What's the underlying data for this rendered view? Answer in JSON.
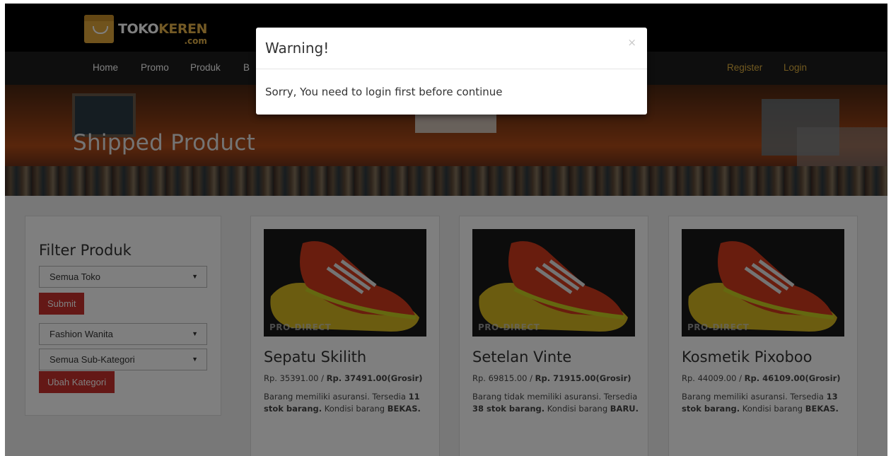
{
  "brand": {
    "name_part1": "TOKO",
    "name_part2": "KEREN",
    "suffix": ".com"
  },
  "nav": {
    "left": [
      "Home",
      "Promo",
      "Produk",
      "B"
    ],
    "right": [
      "Register",
      "Login"
    ]
  },
  "hero": {
    "title": "Shipped Product"
  },
  "filter": {
    "title": "Filter Produk",
    "toko_select": "Semua Toko",
    "submit_label": "Submit",
    "kategori_select": "Fashion Wanita",
    "subkategori_select": "Semua Sub-Kategori",
    "ubah_label": "Ubah Kategori"
  },
  "products": [
    {
      "name": "Sepatu Skilith",
      "price": "Rp. 35391.00 / ",
      "price_grosir": "Rp. 37491.00(Grosir)",
      "desc_pre": "Barang memiliki asuransi. Tersedia ",
      "stock": "11 stok barang.",
      "desc_mid": " Kondisi barang ",
      "condition": "BEKAS.",
      "image_brand": "PRO-DIRECT"
    },
    {
      "name": "Setelan Vinte",
      "price": "Rp. 69815.00 / ",
      "price_grosir": "Rp. 71915.00(Grosir)",
      "desc_pre": "Barang tidak memiliki asuransi. Tersedia ",
      "stock": "38 stok barang.",
      "desc_mid": " Kondisi barang ",
      "condition": "BARU.",
      "image_brand": "PRO-DIRECT"
    },
    {
      "name": "Kosmetik Pixoboo",
      "price": "Rp. 44009.00 / ",
      "price_grosir": "Rp. 46109.00(Grosir)",
      "desc_pre": "Barang memiliki asuransi. Tersedia ",
      "stock": "13 stok barang.",
      "desc_mid": " Kondisi barang ",
      "condition": "BEKAS.",
      "image_brand": "PRO-DIRECT"
    }
  ],
  "modal": {
    "title": "Warning!",
    "close": "×",
    "message": "Sorry, You need to login first before continue"
  },
  "colors": {
    "accent_red": "#c9302c",
    "nav_gold": "#e3b341",
    "brand_gold": "#e8b54a"
  }
}
